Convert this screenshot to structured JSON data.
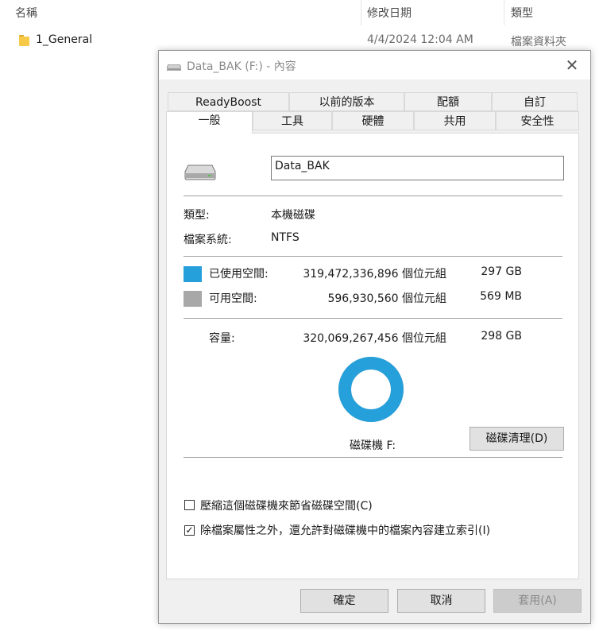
{
  "explorer": {
    "columns": {
      "name": "名稱",
      "date_modified": "修改日期",
      "type": "類型"
    },
    "rows": [
      {
        "name": "1_General",
        "date": "4/4/2024 12:04 AM",
        "type": "檔案資料夾"
      }
    ]
  },
  "dialog": {
    "title": "Data_BAK (F:) - 內容",
    "tabs_top": [
      "ReadyBoost",
      "以前的版本",
      "配額",
      "自訂"
    ],
    "tabs_bottom": [
      "一般",
      "工具",
      "硬體",
      "共用",
      "安全性"
    ],
    "active_tab": "一般",
    "volume_label": "Data_BAK",
    "type_label": "類型:",
    "type_value": "本機磁碟",
    "fs_label": "檔案系統:",
    "fs_value": "NTFS",
    "used": {
      "label": "已使用空間:",
      "bytes": "319,472,336,896 個位元組",
      "size": "297 GB",
      "color": "#26a0da"
    },
    "free": {
      "label": "可用空間:",
      "bytes": "596,930,560 個位元組",
      "size": "569 MB",
      "color": "#a8a8a8"
    },
    "capacity": {
      "label": "容量:",
      "bytes": "320,069,267,456 個位元組",
      "size": "298 GB"
    },
    "used_fraction": 0.9981,
    "drive_label": "磁碟機 F:",
    "cleanup_button": "磁碟清理(D)",
    "compress_checkbox": {
      "label": "壓縮這個磁碟機來節省磁碟空間(C)",
      "checked": false
    },
    "index_checkbox": {
      "label": "除檔案屬性之外，還允許對磁碟機中的檔案內容建立索引(I)",
      "checked": true
    },
    "ok_button": "確定",
    "cancel_button": "取消",
    "apply_button": "套用(A)"
  }
}
